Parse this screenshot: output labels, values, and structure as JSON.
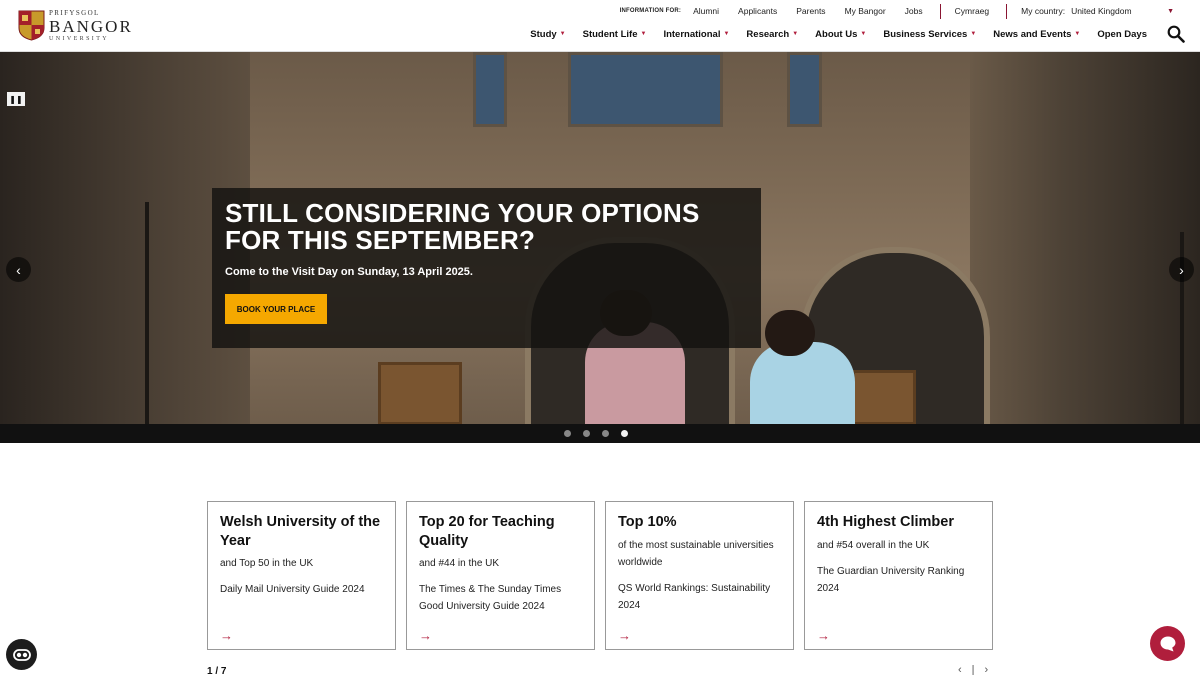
{
  "brand": {
    "line1": "PRIFYSGOL",
    "line2": "BANGOR",
    "line3": "UNIVERSITY",
    "accent_color": "#b01e3c",
    "cta_color": "#f5a800"
  },
  "utility_bar": {
    "label": "INFORMATION FOR:",
    "links": [
      "Alumni",
      "Applicants",
      "Parents",
      "My Bangor",
      "Jobs"
    ],
    "language": "Cymraeg",
    "country_label": "My country:",
    "country_value": "United Kingdom"
  },
  "main_nav": {
    "items": [
      {
        "label": "Study",
        "has_dropdown": true
      },
      {
        "label": "Student Life",
        "has_dropdown": true
      },
      {
        "label": "International",
        "has_dropdown": true
      },
      {
        "label": "Research",
        "has_dropdown": true
      },
      {
        "label": "About Us",
        "has_dropdown": true
      },
      {
        "label": "Business Services",
        "has_dropdown": true
      },
      {
        "label": "News and Events",
        "has_dropdown": true
      },
      {
        "label": "Open Days",
        "has_dropdown": false
      }
    ],
    "search_icon": "search-icon"
  },
  "hero": {
    "heading": "STILL CONSIDERING YOUR OPTIONS FOR THIS SEPTEMBER?",
    "subheading": "Come to the Visit Day on Sunday, 13 April 2025.",
    "cta_label": "BOOK YOUR PLACE",
    "pause_icon": "pause-icon",
    "prev_arrow": "‹",
    "next_arrow": "›",
    "slide_count": 4,
    "active_slide": 4
  },
  "stats_cards": [
    {
      "title": "Welsh University of the Year",
      "sub": "and Top 50 in the UK",
      "source": "Daily Mail University Guide 2024",
      "arrow": "→"
    },
    {
      "title": "Top 20 for Teaching Quality",
      "sub": "and #44 in the UK",
      "source": "The Times & The Sunday Times Good University Guide 2024",
      "arrow": "→"
    },
    {
      "title": "Top 10%",
      "sub": "of the most sustainable universities worldwide",
      "source": "QS World Rankings: Sustainability 2024",
      "arrow": "→"
    },
    {
      "title": "4th Highest Climber",
      "sub": "and #54 overall in the UK",
      "source": "The Guardian University Ranking 2024",
      "arrow": "→"
    }
  ],
  "pager": {
    "text": "1 / 7",
    "prev": "‹",
    "divider": "|",
    "next": "›"
  }
}
